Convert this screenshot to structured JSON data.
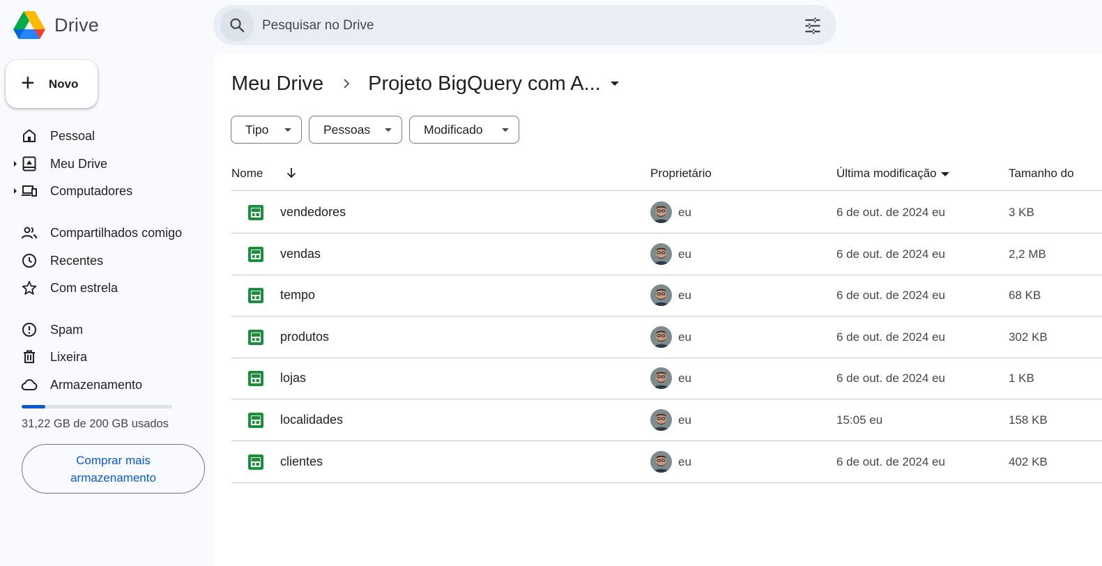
{
  "app": {
    "name": "Drive"
  },
  "search": {
    "placeholder": "Pesquisar no Drive",
    "value": ""
  },
  "sidebar": {
    "new_label": "Novo",
    "items": [
      {
        "label": "Pessoal",
        "icon": "home-icon",
        "expandable": false
      },
      {
        "label": "Meu Drive",
        "icon": "my-drive-icon",
        "expandable": true
      },
      {
        "label": "Computadores",
        "icon": "computers-icon",
        "expandable": true
      },
      {
        "label": "Compartilhados comigo",
        "icon": "people-icon",
        "expandable": false
      },
      {
        "label": "Recentes",
        "icon": "clock-icon",
        "expandable": false
      },
      {
        "label": "Com estrela",
        "icon": "star-icon",
        "expandable": false
      },
      {
        "label": "Spam",
        "icon": "spam-icon",
        "expandable": false
      },
      {
        "label": "Lixeira",
        "icon": "trash-icon",
        "expandable": false
      },
      {
        "label": "Armazenamento",
        "icon": "cloud-icon",
        "expandable": false
      }
    ],
    "storage": {
      "used_text": "31,22 GB de 200 GB usados",
      "used_fraction": 0.156
    },
    "buy_storage_label": "Comprar mais armazenamento"
  },
  "breadcrumb": {
    "root": "Meu Drive",
    "current": "Projeto BigQuery com A..."
  },
  "filters": [
    "Tipo",
    "Pessoas",
    "Modificado"
  ],
  "table": {
    "headers": {
      "name": "Nome",
      "owner": "Proprietário",
      "modified": "Última modificação",
      "size": "Tamanho do"
    },
    "rows": [
      {
        "name": "vendedores",
        "owner": "eu",
        "modified": "6 de out. de 2024 eu",
        "size": "3 KB"
      },
      {
        "name": "vendas",
        "owner": "eu",
        "modified": "6 de out. de 2024 eu",
        "size": "2,2 MB"
      },
      {
        "name": "tempo",
        "owner": "eu",
        "modified": "6 de out. de 2024 eu",
        "size": "68 KB"
      },
      {
        "name": "produtos",
        "owner": "eu",
        "modified": "6 de out. de 2024 eu",
        "size": "302 KB"
      },
      {
        "name": "lojas",
        "owner": "eu",
        "modified": "6 de out. de 2024 eu",
        "size": "1 KB"
      },
      {
        "name": "localidades",
        "owner": "eu",
        "modified": "15:05 eu",
        "size": "158 KB"
      },
      {
        "name": "clientes",
        "owner": "eu",
        "modified": "6 de out. de 2024 eu",
        "size": "402 KB"
      }
    ]
  },
  "colors": {
    "accent": "#0b57d0",
    "sheets_green": "#1e8e3e",
    "search_bg": "#e9eef6",
    "page_bg": "#f8fafd"
  }
}
